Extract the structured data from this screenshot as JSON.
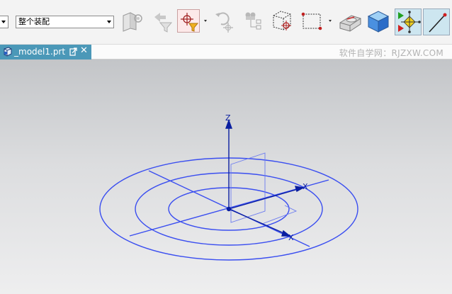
{
  "toolbar": {
    "type_filter_value": "",
    "scope_filter_value": "整个装配",
    "buttons": [
      {
        "name": "face-rule-icon"
      },
      {
        "name": "filter-icon"
      },
      {
        "name": "general-selection-filter-icon"
      },
      {
        "name": "undo-selection-icon"
      },
      {
        "name": "snap-point-icon"
      },
      {
        "name": "view-box-icon"
      },
      {
        "name": "rectangle-select-icon"
      },
      {
        "name": "shaded-model-icon"
      },
      {
        "name": "blue-solid-icon"
      },
      {
        "name": "move-handles-icon"
      },
      {
        "name": "line-tool-icon"
      }
    ]
  },
  "tab": {
    "title": "_model1.prt",
    "close": "✕"
  },
  "watermark": "软件自学网：RJZXW.COM",
  "viewport": {
    "axis_z": "Z",
    "axis_x": "X",
    "axis_y": "X",
    "colors": {
      "curve": "#3a4ef0",
      "axis": "#0a1ea0",
      "background_top": "#c3c5c8",
      "background_bottom": "#eeeeef"
    }
  }
}
